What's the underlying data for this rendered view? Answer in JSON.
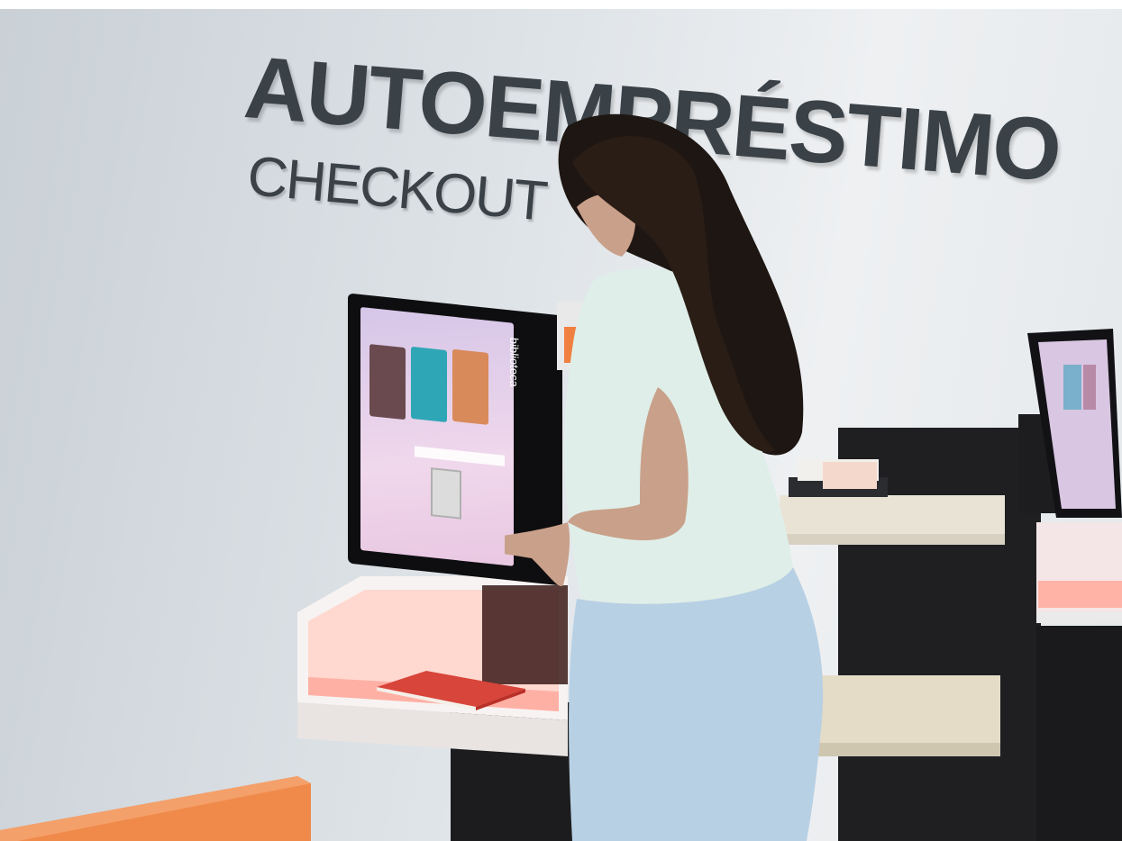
{
  "sign": {
    "line1": "AUTOEMPRÉSTIMO",
    "line2": "CHECKOUT"
  },
  "kiosk": {
    "brand": "biblioteca"
  },
  "colors": {
    "wall": "#dfe4e8",
    "sign_text": "#3a4248",
    "accent_orange": "#f08040",
    "kiosk_glow": "#ff9a8a",
    "shelf_dark": "#1c1c1e",
    "shirt": "#dfeee8",
    "jeans": "#b8d0e4",
    "hair": "#1e1612"
  }
}
